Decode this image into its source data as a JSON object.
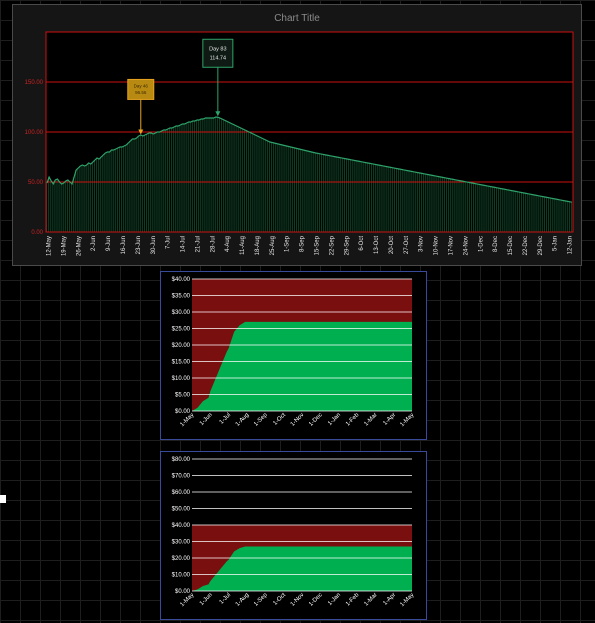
{
  "chart_data": [
    {
      "type": "area",
      "title": "Chart Title",
      "ylim": [
        0,
        200
      ],
      "y_ticks": [
        "0.00",
        "50.00",
        "100.00",
        "150.00"
      ],
      "x_tick_labels": [
        "12-May",
        "19-May",
        "26-May",
        "2-Jun",
        "9-Jun",
        "16-Jun",
        "23-Jun",
        "30-Jun",
        "7-Jul",
        "14-Jul",
        "21-Jul",
        "28-Jul",
        "4-Aug",
        "11-Aug",
        "18-Aug",
        "25-Aug",
        "1-Sep",
        "8-Sep",
        "15-Sep",
        "22-Sep",
        "29-Sep",
        "6-Oct",
        "13-Oct",
        "20-Oct",
        "27-Oct",
        "3-Nov",
        "10-Nov",
        "17-Nov",
        "24-Nov",
        "1-Dec",
        "8-Dec",
        "15-Dec",
        "22-Dec",
        "29-Dec",
        "5-Jan",
        "12-Jan"
      ],
      "series": [
        {
          "values": [
            49,
            55,
            51,
            48,
            52,
            53,
            50,
            48,
            49,
            51,
            52,
            50,
            48,
            55,
            62,
            64,
            66,
            67,
            66,
            67,
            69,
            68,
            70,
            72,
            74,
            73,
            75,
            77,
            79,
            80,
            80,
            82,
            82,
            83,
            84,
            85,
            85,
            86,
            87,
            89,
            91,
            93,
            93,
            94,
            96,
            97,
            96,
            97,
            98,
            99,
            99,
            98,
            99,
            100,
            100,
            101,
            102,
            102,
            103,
            104,
            104,
            105,
            106,
            106,
            107,
            108,
            108,
            109,
            110,
            110,
            111,
            111,
            112,
            112,
            113,
            113,
            114,
            114,
            114,
            114,
            114,
            115,
            114.74,
            114,
            113,
            112,
            111,
            110,
            109,
            108,
            107,
            106,
            105,
            104,
            103,
            102,
            101,
            100,
            99,
            98,
            97,
            96,
            95,
            94,
            93,
            92,
            91,
            90,
            89.5,
            89,
            88.5,
            88,
            87.5,
            87,
            86.5,
            86,
            85.5,
            85,
            84.5,
            84,
            83.5,
            83,
            82.5,
            82,
            81.5,
            81,
            80.5,
            80,
            79.5,
            79,
            78.6,
            78.2,
            77.8,
            77.4,
            77,
            76.6,
            76.2,
            75.8,
            75.4,
            75,
            74.6,
            74.2,
            73.8,
            73.4,
            73,
            72.6,
            72.2,
            71.8,
            71.4,
            71,
            70.6,
            70.2,
            69.8,
            69.4,
            69,
            68.6,
            68.2,
            67.8,
            67.4,
            67,
            66.6,
            66.2,
            65.8,
            65.4,
            65,
            64.6,
            64.2,
            63.8,
            63.4,
            63,
            62.6,
            62.2,
            61.8,
            61.4,
            61,
            60.6,
            60.2,
            59.8,
            59.4,
            59,
            58.6,
            58.2,
            57.8,
            57.4,
            57,
            56.6,
            56.2,
            55.8,
            55.4,
            55,
            54.6,
            54.2,
            53.8,
            53.4,
            53,
            52.6,
            52.2,
            51.8,
            51.4,
            51,
            50.6,
            50.2,
            49.8,
            49.4,
            49,
            48.6,
            48.2,
            47.8,
            47.4,
            47,
            46.6,
            46.2,
            45.8,
            45.4,
            45,
            44.6,
            44.2,
            43.8,
            43.4,
            43,
            42.6,
            42.2,
            41.8,
            41.4,
            41,
            40.6,
            40.2,
            39.8,
            39.4,
            39,
            38.6,
            38.2,
            37.8,
            37.4,
            37,
            36.6,
            36.2,
            35.8,
            35.4,
            35,
            34.6,
            34.2,
            33.8,
            33.4,
            33,
            32.6,
            32.2,
            31.8,
            31.4,
            31,
            30.6,
            30.2,
            29.8
          ]
        }
      ],
      "annotations": [
        {
          "line1": "Day 83",
          "line2": "114.74",
          "day": 83,
          "value": 114.74
        },
        {
          "line1": "Day 46",
          "line2": "96.56",
          "day": 46,
          "value": 96.56
        }
      ],
      "colors": {
        "line": "#2ea36a",
        "bars": "#0f3d24",
        "grid": "#cc1111",
        "label": "#cc2222",
        "annotation_green": "#2ea36a",
        "annotation_yellow": "#e6a21f"
      },
      "grid": true
    },
    {
      "type": "area",
      "ylim": [
        0,
        40
      ],
      "y_ticks": [
        "$0.00",
        "$5.00",
        "$10.00",
        "$15.00",
        "$20.00",
        "$25.00",
        "$30.00",
        "$35.00",
        "$40.00"
      ],
      "x_tick_labels": [
        "1-May",
        "1-Jun",
        "1-Jul",
        "1-Aug",
        "1-Sep",
        "1-Oct",
        "1-Nov",
        "1-Dec",
        "1-Jan",
        "1-Feb",
        "1-Mar",
        "1-Apr",
        "1-May"
      ],
      "band": {
        "from": 0,
        "to": 40,
        "color": "#7a0f0f"
      },
      "series": [
        {
          "x": [
            0,
            0.3,
            0.6,
            0.9,
            1.0,
            1.3,
            1.6,
            1.9,
            2.0,
            2.3,
            2.6,
            2.9,
            3.0,
            12
          ],
          "values": [
            0,
            1,
            3,
            4,
            6,
            10,
            14,
            18,
            19,
            24,
            26,
            27,
            27,
            27
          ],
          "color": "#00b050"
        }
      ],
      "colors": {
        "grid": "#ffffff",
        "fill": "#00b050"
      },
      "grid": true
    },
    {
      "type": "area",
      "ylim": [
        0,
        80
      ],
      "y_ticks": [
        "$0.00",
        "$10.00",
        "$20.00",
        "$30.00",
        "$40.00",
        "$50.00",
        "$60.00",
        "$70.00",
        "$80.00"
      ],
      "x_tick_labels": [
        "1-May",
        "1-Jun",
        "1-Jul",
        "1-Aug",
        "1-Sep",
        "1-Oct",
        "1-Nov",
        "1-Dec",
        "1-Jan",
        "1-Feb",
        "1-Mar",
        "1-Apr",
        "1-May"
      ],
      "band": {
        "from": 0,
        "to": 40,
        "color": "#7a0f0f"
      },
      "series": [
        {
          "x": [
            0,
            0.3,
            0.6,
            0.9,
            1.0,
            1.3,
            1.6,
            1.9,
            2.0,
            2.3,
            2.6,
            2.9,
            3.0,
            12
          ],
          "values": [
            0,
            1,
            3,
            4,
            6,
            10,
            14,
            18,
            19,
            24,
            26,
            27,
            27,
            27
          ],
          "color": "#00b050"
        }
      ],
      "colors": {
        "grid": "#ffffff",
        "fill": "#00b050"
      },
      "grid": true
    }
  ]
}
